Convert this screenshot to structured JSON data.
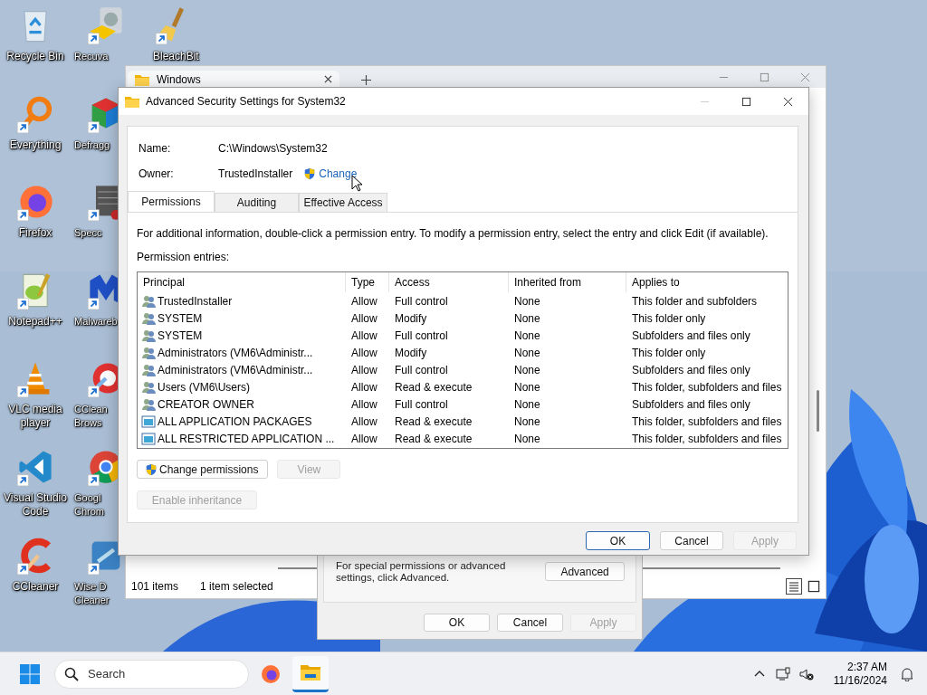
{
  "desktop": {
    "icons_column_1": [
      {
        "label": "Recycle Bin",
        "shortcut": false
      },
      {
        "label": "Everything",
        "shortcut": true
      },
      {
        "label": "Firefox",
        "shortcut": true
      },
      {
        "label": "Notepad++",
        "shortcut": true
      },
      {
        "label": "VLC media player",
        "shortcut": true
      },
      {
        "label": "Visual Studio Code",
        "shortcut": true
      },
      {
        "label": "CCleaner",
        "shortcut": true
      }
    ],
    "icons_column_2": [
      {
        "label": "Recuva",
        "shortcut": true
      },
      {
        "label": "Defragg",
        "shortcut": true
      },
      {
        "label": "Specc",
        "shortcut": true
      },
      {
        "label": "Malwareb",
        "shortcut": true
      },
      {
        "label": "CClean\nBrows",
        "shortcut": true
      },
      {
        "label": "Googl\nChrom",
        "shortcut": true
      },
      {
        "label": "Wise D\nCleaner",
        "shortcut": true
      }
    ],
    "icons_column_3": [
      {
        "label": "BleachBit",
        "shortcut": true
      }
    ]
  },
  "explorer_window": {
    "tab_title": "Windows",
    "status_bar": {
      "item_count": "101 items",
      "selection": "1 item selected"
    }
  },
  "properties_dialog": {
    "advanced_text": "For special permissions or advanced settings, click Advanced.",
    "advanced_button": "Advanced",
    "buttons": [
      {
        "label": "OK",
        "disabled": false
      },
      {
        "label": "Cancel",
        "disabled": false
      },
      {
        "label": "Apply",
        "disabled": true
      }
    ]
  },
  "advanced_dialog": {
    "title": "Advanced Security Settings for System32",
    "name_label": "Name:",
    "name_value": "C:\\Windows\\System32",
    "owner_label": "Owner:",
    "owner_value": "TrustedInstaller",
    "owner_change_link": "Change",
    "tabs": [
      {
        "label": "Permissions",
        "selected": true
      },
      {
        "label": "Auditing",
        "selected": false
      },
      {
        "label": "Effective Access",
        "selected": false
      }
    ],
    "info_text": "For additional information, double-click a permission entry. To modify a permission entry, select the entry and click Edit (if available).",
    "entries_label": "Permission entries:",
    "table": {
      "columns": [
        "Principal",
        "Type",
        "Access",
        "Inherited from",
        "Applies to"
      ],
      "rows": [
        {
          "kind": "user",
          "principal": "TrustedInstaller",
          "type": "Allow",
          "access": "Full control",
          "inherited_from": "None",
          "applies_to": "This folder and subfolders"
        },
        {
          "kind": "user",
          "principal": "SYSTEM",
          "type": "Allow",
          "access": "Modify",
          "inherited_from": "None",
          "applies_to": "This folder only"
        },
        {
          "kind": "user",
          "principal": "SYSTEM",
          "type": "Allow",
          "access": "Full control",
          "inherited_from": "None",
          "applies_to": "Subfolders and files only"
        },
        {
          "kind": "user",
          "principal": "Administrators (VM6\\Administr...",
          "type": "Allow",
          "access": "Modify",
          "inherited_from": "None",
          "applies_to": "This folder only"
        },
        {
          "kind": "user",
          "principal": "Administrators (VM6\\Administr...",
          "type": "Allow",
          "access": "Full control",
          "inherited_from": "None",
          "applies_to": "Subfolders and files only"
        },
        {
          "kind": "user",
          "principal": "Users (VM6\\Users)",
          "type": "Allow",
          "access": "Read & execute",
          "inherited_from": "None",
          "applies_to": "This folder, subfolders and files"
        },
        {
          "kind": "user",
          "principal": "CREATOR OWNER",
          "type": "Allow",
          "access": "Full control",
          "inherited_from": "None",
          "applies_to": "Subfolders and files only"
        },
        {
          "kind": "package",
          "principal": "ALL APPLICATION PACKAGES",
          "type": "Allow",
          "access": "Read & execute",
          "inherited_from": "None",
          "applies_to": "This folder, subfolders and files"
        },
        {
          "kind": "package",
          "principal": "ALL RESTRICTED APPLICATION ...",
          "type": "Allow",
          "access": "Read & execute",
          "inherited_from": "None",
          "applies_to": "This folder, subfolders and files"
        }
      ]
    },
    "change_permissions_button": {
      "label": "Change permissions",
      "disabled": false
    },
    "view_button": {
      "label": "View",
      "disabled": true
    },
    "enable_inheritance_button": {
      "label": "Enable inheritance",
      "disabled": true
    },
    "buttons": [
      {
        "label": "OK",
        "default": true,
        "disabled": false
      },
      {
        "label": "Cancel",
        "default": false,
        "disabled": false
      },
      {
        "label": "Apply",
        "default": false,
        "disabled": true
      }
    ]
  },
  "taskbar": {
    "search_placeholder": "Search",
    "apps": [
      {
        "kind": "firefox",
        "active": false
      },
      {
        "kind": "explorer",
        "active": true
      }
    ],
    "time": "2:37 AM",
    "date": "11/16/2024"
  }
}
